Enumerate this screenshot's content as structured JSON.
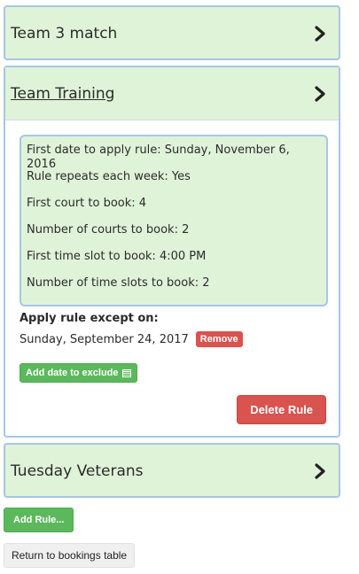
{
  "panels": [
    {
      "title": "Team 3 match"
    },
    {
      "title": "Team Training"
    },
    {
      "title": "Tuesday Veterans"
    }
  ],
  "rule": {
    "first_date": "First date to apply rule: Sunday, November 6, 2016",
    "repeats": "Rule repeats each week: Yes",
    "first_court": "First court to book: 4",
    "num_courts": "Number of courts to book: 2",
    "first_slot": "First time slot to book: 4:00 PM",
    "num_slots": "Number of time slots to book: 2"
  },
  "exceptions": {
    "label": "Apply rule except on:",
    "date": "Sunday, September 24, 2017",
    "remove_label": "Remove",
    "add_label": "Add date to exclude"
  },
  "actions": {
    "delete_rule": "Delete Rule",
    "add_rule": "Add Rule...",
    "return": "Return to bookings table"
  },
  "icons": {
    "expand": "chevron-right-icon",
    "calendar": "calendar-icon"
  },
  "colors": {
    "panel_bg": "#dff3d8",
    "panel_border": "#a8c6e6",
    "danger": "#d9534f",
    "success": "#5cb85c"
  }
}
